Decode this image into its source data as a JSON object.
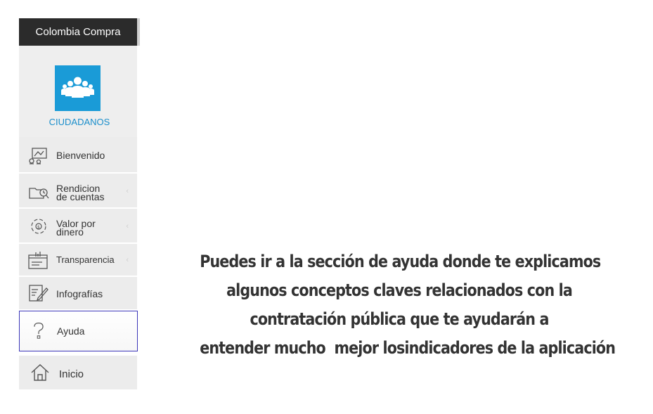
{
  "sidebar": {
    "header": "Colombia Compra",
    "profile": {
      "label": "CIUDADANOS",
      "icon": "people-group-icon",
      "color": "#1a9bd7"
    },
    "items": [
      {
        "label": "Bienvenido",
        "icon": "welcome-board-icon"
      },
      {
        "label_line1": "Rendicion",
        "label_line2": "de cuentas",
        "icon": "folder-search-icon",
        "chevron": "‹"
      },
      {
        "label_line1": "Valor por",
        "label_line2": "dinero",
        "icon": "money-cycle-icon",
        "chevron": "‹"
      },
      {
        "label": "Transparencia",
        "icon": "transparency-chart-icon",
        "chevron": "‹"
      },
      {
        "label": "Infografías",
        "icon": "edit-document-icon"
      },
      {
        "label": "Ayuda",
        "icon": "question-mark-icon"
      },
      {
        "label": "Inicio",
        "icon": "home-icon"
      }
    ]
  },
  "message": {
    "line1": "Puedes ir a la sección de ayuda donde te explicamos",
    "line2": "algunos conceptos claves relacionados con la",
    "line3": "contratación pública que te ayudarán a",
    "line4": "entender mucho  mejor losindicadores de la aplicación"
  }
}
